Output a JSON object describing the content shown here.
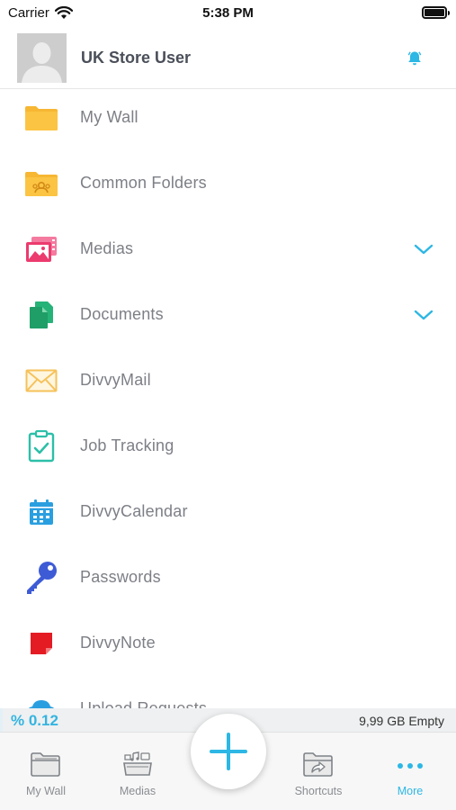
{
  "status_bar": {
    "carrier": "Carrier",
    "time": "5:38 PM"
  },
  "header": {
    "user_name": "UK Store User"
  },
  "menu": {
    "items": [
      {
        "label": "My Wall",
        "icon": "folder-icon"
      },
      {
        "label": "Common Folders",
        "icon": "shared-folder-icon"
      },
      {
        "label": "Medias",
        "icon": "media-icon",
        "expandable": true
      },
      {
        "label": "Documents",
        "icon": "documents-icon",
        "expandable": true
      },
      {
        "label": "DivvyMail",
        "icon": "mail-icon"
      },
      {
        "label": "Job Tracking",
        "icon": "clipboard-check-icon"
      },
      {
        "label": "DivvyCalendar",
        "icon": "calendar-icon"
      },
      {
        "label": "Passwords",
        "icon": "key-icon"
      },
      {
        "label": "DivvyNote",
        "icon": "note-icon"
      },
      {
        "label": "Upload Requests",
        "icon": "cloud-upload-icon"
      }
    ]
  },
  "storage": {
    "percent_label": "% 0.12",
    "used_fraction": 0.0012,
    "free_label": "9,99 GB Empty"
  },
  "tabbar": {
    "tabs": [
      {
        "label": "My Wall",
        "icon": "folder-outline-icon"
      },
      {
        "label": "Medias",
        "icon": "media-tray-icon"
      },
      {
        "label": "Shortcuts",
        "icon": "shortcut-folder-icon"
      },
      {
        "label": "More",
        "icon": "more-dots-icon",
        "active": true
      }
    ],
    "add_icon": "plus-icon"
  },
  "colors": {
    "accent": "#2cb7e4",
    "folder": "#f7b733",
    "media": "#ec3b6e",
    "documents": "#26b377",
    "mail": "#f5c25b",
    "job": "#2cbfa8",
    "calendar": "#2a9fe0",
    "key": "#3e5bd6",
    "note": "#e41b23"
  }
}
